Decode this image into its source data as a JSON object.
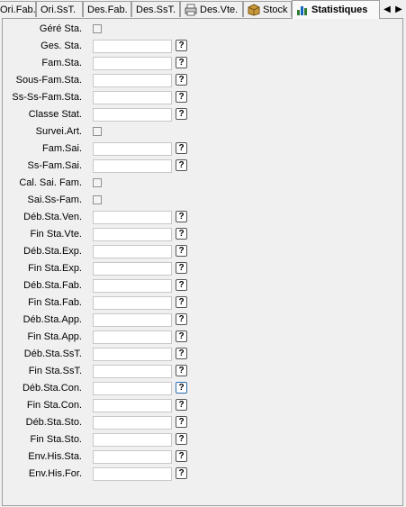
{
  "tabs": [
    {
      "label": "Ori.Fab.",
      "icon": ""
    },
    {
      "label": "Ori.SsT.",
      "icon": ""
    },
    {
      "label": "Des.Fab.",
      "icon": ""
    },
    {
      "label": "Des.SsT.",
      "icon": ""
    },
    {
      "label": "Des.Vte.",
      "icon": "printer-icon"
    },
    {
      "label": "Stock",
      "icon": "box-icon"
    },
    {
      "label": "Statistiques",
      "icon": "chart-icon"
    }
  ],
  "nav": {
    "prev_icon": "scroll-left-icon",
    "next_icon": "scroll-right-icon"
  },
  "help_label": "?",
  "fields": [
    {
      "label": "Géré Sta.",
      "type": "checkbox"
    },
    {
      "label": "Ges. Sta.",
      "type": "text"
    },
    {
      "label": "Fam.Sta.",
      "type": "text"
    },
    {
      "label": "Sous-Fam.Sta.",
      "type": "text"
    },
    {
      "label": "Ss-Ss-Fam.Sta.",
      "type": "text"
    },
    {
      "label": "Classe Stat.",
      "type": "text"
    },
    {
      "label": "Survei.Art.",
      "type": "checkbox"
    },
    {
      "label": "Fam.Sai.",
      "type": "text"
    },
    {
      "label": "Ss-Fam.Sai.",
      "type": "text"
    },
    {
      "label": "Cal. Sai. Fam.",
      "type": "checkbox"
    },
    {
      "label": "Sai.Ss-Fam.",
      "type": "checkbox"
    },
    {
      "label": "Déb.Sta.Ven.",
      "type": "text"
    },
    {
      "label": "Fin Sta.Vte.",
      "type": "text"
    },
    {
      "label": "Déb.Sta.Exp.",
      "type": "text"
    },
    {
      "label": "Fin Sta.Exp.",
      "type": "text"
    },
    {
      "label": "Déb.Sta.Fab.",
      "type": "text"
    },
    {
      "label": "Fin Sta.Fab.",
      "type": "text"
    },
    {
      "label": "Déb.Sta.App.",
      "type": "text"
    },
    {
      "label": "Fin Sta.App.",
      "type": "text"
    },
    {
      "label": "Déb.Sta.SsT.",
      "type": "text"
    },
    {
      "label": "Fin Sta.SsT.",
      "type": "text"
    },
    {
      "label": "Déb.Sta.Con.",
      "type": "text",
      "focused": true
    },
    {
      "label": "Fin Sta.Con.",
      "type": "text"
    },
    {
      "label": "Déb.Sta.Sto.",
      "type": "text"
    },
    {
      "label": "Fin Sta.Sto.",
      "type": "text"
    },
    {
      "label": "Env.His.Sta.",
      "type": "text"
    },
    {
      "label": "Env.His.For.",
      "type": "text"
    }
  ]
}
